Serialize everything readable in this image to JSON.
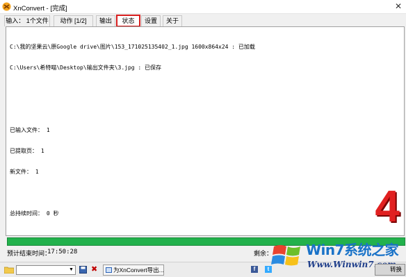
{
  "window": {
    "title": "XnConvert - [完成]",
    "close_glyph": "✕"
  },
  "tabs": [
    {
      "label": "输入： 1个文件"
    },
    {
      "label": "动作 [1/2]"
    },
    {
      "label": "输出"
    },
    {
      "label": "状态",
      "active": true
    },
    {
      "label": "设置"
    },
    {
      "label": "关于"
    }
  ],
  "log": {
    "lines": [
      "C:\\我的坚果云\\原Google drive\\图片\\153_171025135402_1.jpg 1600x864x24 : 已加载",
      "C:\\Users\\希特喵\\Desktop\\输出文件夹\\3.jpg : 已保存",
      "",
      "",
      "已输入文件： 1",
      "已提取页： 1",
      "新文件： 1",
      "",
      "总持续时间： 0 秒"
    ]
  },
  "overlay": {
    "step_number": "4"
  },
  "progress": {
    "fraction": 1.0,
    "color": "#22b14c"
  },
  "status": {
    "eta_label": "预计结束时间：",
    "eta_value": "17:50:28",
    "remaining_label": "剩余："
  },
  "bottombar": {
    "folder_icon": "folder-icon",
    "combo_value": "",
    "export_label": "为XnConvert导出...",
    "facebook_glyph": "f",
    "twitter_glyph": "t",
    "convert_label": "转换"
  },
  "watermark": {
    "brand": "Win7系统之家",
    "url": "Www.Winwin7.com"
  },
  "colors": {
    "accent_tab_border": "#d81e1e",
    "progress_green": "#22b14c",
    "overlay_red": "#e12020"
  }
}
